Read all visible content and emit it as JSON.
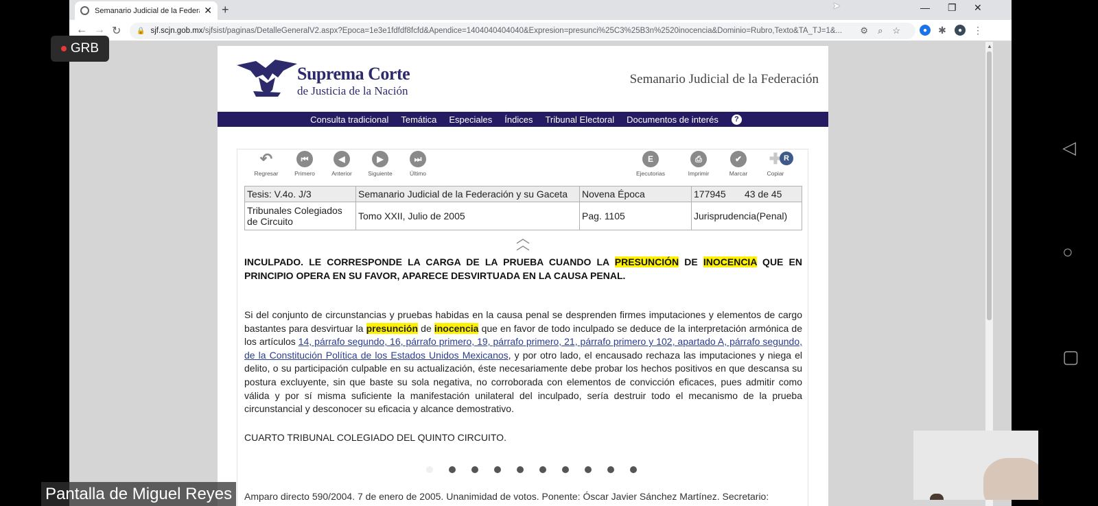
{
  "browser": {
    "tab_title": "Semanario Judicial de la Federac",
    "tab_close": "✕",
    "new_tab": "+",
    "window_controls": {
      "minimize": "—",
      "restore": "❐",
      "close": "✕"
    },
    "url_host": "sjf.scjn.gob.mx",
    "url_rest": "/sjfsist/paginas/DetalleGeneralV2.aspx?Epoca=1e3e1fdfdf8fcfd&Apendice=1404040404040&Expresion=presunci%25C3%25B3n%2520inocencia&Dominio=Rubro,Texto&TA_TJ=1&..."
  },
  "site": {
    "logo_line1": "Suprema Corte",
    "logo_line2": "de Justicia de la Nación",
    "title": "Semanario Judicial de la Federación"
  },
  "nav": {
    "items": [
      "Consulta tradicional",
      "Temática",
      "Especiales",
      "Índices",
      "Tribunal Electoral",
      "Documentos de interés"
    ],
    "help": "?"
  },
  "toolbar": {
    "regresar": "Regresar",
    "primero": "Primero",
    "anterior": "Anterior",
    "siguiente": "Siguiente",
    "ultimo": "Último",
    "ejecutorias": "Ejecutorias",
    "imprimir": "Imprimir",
    "marcar": "Marcar",
    "copiar": "Copiar",
    "r_badge": "R",
    "ejecutorias_icon_letter": "E"
  },
  "tesis": {
    "clave": "Tesis: V.4o. J/3",
    "fuente": "Semanario Judicial de la Federación y su Gaceta",
    "epoca": "Novena Época",
    "registro": "177945",
    "posicion": "43 de 45",
    "instancia": "Tribunales Colegiados de Circuito",
    "tomo": "Tomo XXII, Julio de 2005",
    "pagina": "Pag. 1105",
    "tipo": "Jurisprudencia(Penal)"
  },
  "rubro": {
    "part1": "INCULPADO. LE CORRESPONDE LA CARGA DE LA PRUEBA CUANDO LA ",
    "hl1": "PRESUNCIÓN",
    "part2": " DE ",
    "hl2": "INOCENCIA",
    "part3": " QUE EN PRINCIPIO OPERA EN SU FAVOR, APARECE DESVIRTUADA EN LA CAUSA PENAL."
  },
  "texto": {
    "part1": "Si del conjunto de circunstancias y pruebas habidas en la causa penal se desprenden firmes imputaciones y elementos de cargo bastantes para desvirtuar la ",
    "hl1": "presunción",
    "part2": " de ",
    "hl2": "inocencia",
    "part3": " que en favor de todo inculpado se deduce de la interpretación armónica de los artículos ",
    "link": "14, párrafo segundo, 16, párrafo primero, 19, párrafo primero, 21, párrafo primero y 102, apartado A, párrafo segundo, de la Constitución Política de los Estados Unidos Mexicanos",
    "part4": ", y por otro lado, el encausado rechaza las imputaciones y niega el delito, o su participación culpable en su actualización, éste necesariamente debe probar los hechos positivos en que descansa su postura excluyente, sin que baste su sola negativa, no corroborada con elementos de convicción eficaces, pues admitir como válida y por sí misma suficiente la manifestación unilateral del inculpado, sería destruir todo el mecanismo de la prueba circunstancial y desconocer su eficacia y alcance demostrativo."
  },
  "precedente": "CUARTO TRIBUNAL COLEGIADO DEL QUINTO CIRCUITO.",
  "cut_line": "Amparo directo 590/2004. 7 de enero de 2005. Unanimidad de votos. Ponente: Óscar Javier Sánchez Martínez. Secretario:",
  "meeting": {
    "rec_label": "GRB",
    "share_label": "Pantalla de Miguel Reyes"
  },
  "colors": {
    "nav_bg": "#241b63",
    "logo_blue": "#2c2a6b",
    "highlight": "#fff200",
    "link": "#2a3d8f"
  }
}
